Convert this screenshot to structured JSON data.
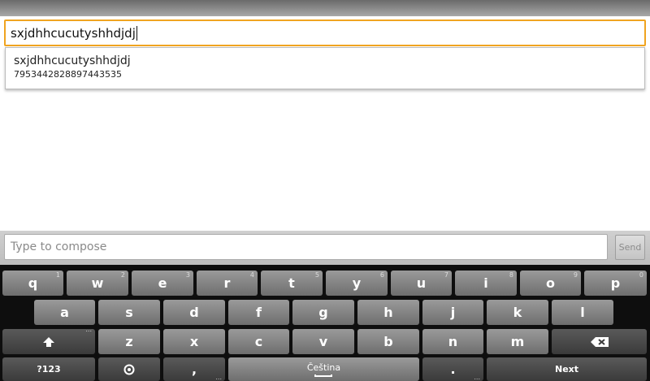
{
  "recipient": {
    "value": "sxjdhhcucutyshhdjdj"
  },
  "suggestion": {
    "name": "sxjdhhcucutyshhdjdj",
    "number": "7953442828897443535"
  },
  "compose": {
    "placeholder": "Type to compose",
    "send_label": "Send"
  },
  "keyboard": {
    "row1": [
      {
        "label": "q",
        "hint": "1"
      },
      {
        "label": "w",
        "hint": "2"
      },
      {
        "label": "e",
        "hint": "3"
      },
      {
        "label": "r",
        "hint": "4"
      },
      {
        "label": "t",
        "hint": "5"
      },
      {
        "label": "y",
        "hint": "6"
      },
      {
        "label": "u",
        "hint": "7"
      },
      {
        "label": "i",
        "hint": "8"
      },
      {
        "label": "o",
        "hint": "9"
      },
      {
        "label": "p",
        "hint": "0"
      }
    ],
    "row2": [
      "a",
      "s",
      "d",
      "f",
      "g",
      "h",
      "j",
      "k",
      "l"
    ],
    "row3": [
      "z",
      "x",
      "c",
      "v",
      "b",
      "n",
      "m"
    ],
    "symbols_label": "?123",
    "comma_label": ",",
    "space_label": "Čeština",
    "period_label": ".",
    "next_label": "Next",
    "dots": "..."
  }
}
